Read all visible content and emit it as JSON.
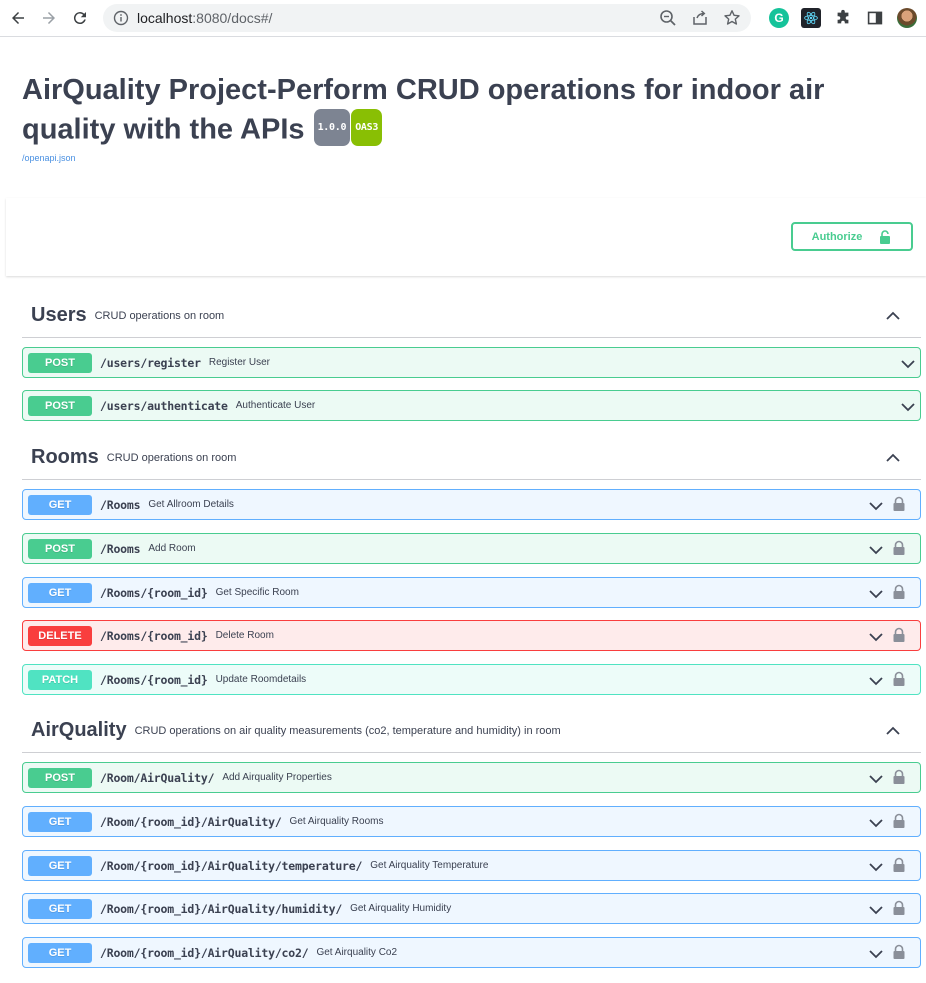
{
  "browser": {
    "url_host": "localhost",
    "url_rest": ":8080/docs#/"
  },
  "api": {
    "title": "AirQuality Project-Perform CRUD operations for indoor air quality with the APIs",
    "version_badge": "1.0.0",
    "oas_badge": "OAS3",
    "spec_link": "/openapi.json"
  },
  "authorize_label": "Authorize",
  "colors": {
    "post": "#49cc90",
    "get": "#61affe",
    "delete": "#f93e3e",
    "patch": "#50e3c2"
  },
  "tags": [
    {
      "name": "Users",
      "description": "CRUD operations on room",
      "operations": [
        {
          "method": "POST",
          "path": "/users/register",
          "summary": "Register User",
          "locked": false
        },
        {
          "method": "POST",
          "path": "/users/authenticate",
          "summary": "Authenticate User",
          "locked": false
        }
      ]
    },
    {
      "name": "Rooms",
      "description": "CRUD operations on room",
      "operations": [
        {
          "method": "GET",
          "path": "/Rooms",
          "summary": "Get Allroom Details",
          "locked": true
        },
        {
          "method": "POST",
          "path": "/Rooms",
          "summary": "Add Room",
          "locked": true
        },
        {
          "method": "GET",
          "path": "/Rooms/{room_id}",
          "summary": "Get Specific Room",
          "locked": true
        },
        {
          "method": "DELETE",
          "path": "/Rooms/{room_id}",
          "summary": "Delete Room",
          "locked": true
        },
        {
          "method": "PATCH",
          "path": "/Rooms/{room_id}",
          "summary": "Update Roomdetails",
          "locked": true
        }
      ]
    },
    {
      "name": "AirQuality",
      "description": "CRUD operations on air quality measurements (co2, temperature and humidity) in room",
      "operations": [
        {
          "method": "POST",
          "path": "/Room/AirQuality/",
          "summary": "Add Airquality Properties",
          "locked": true
        },
        {
          "method": "GET",
          "path": "/Room/{room_id}/AirQuality/",
          "summary": "Get Airquality Rooms",
          "locked": true
        },
        {
          "method": "GET",
          "path": "/Room/{room_id}/AirQuality/temperature/",
          "summary": "Get Airquality Temperature",
          "locked": true
        },
        {
          "method": "GET",
          "path": "/Room/{room_id}/AirQuality/humidity/",
          "summary": "Get Airquality Humidity",
          "locked": true
        },
        {
          "method": "GET",
          "path": "/Room/{room_id}/AirQuality/co2/",
          "summary": "Get Airquality Co2",
          "locked": true
        }
      ]
    }
  ]
}
